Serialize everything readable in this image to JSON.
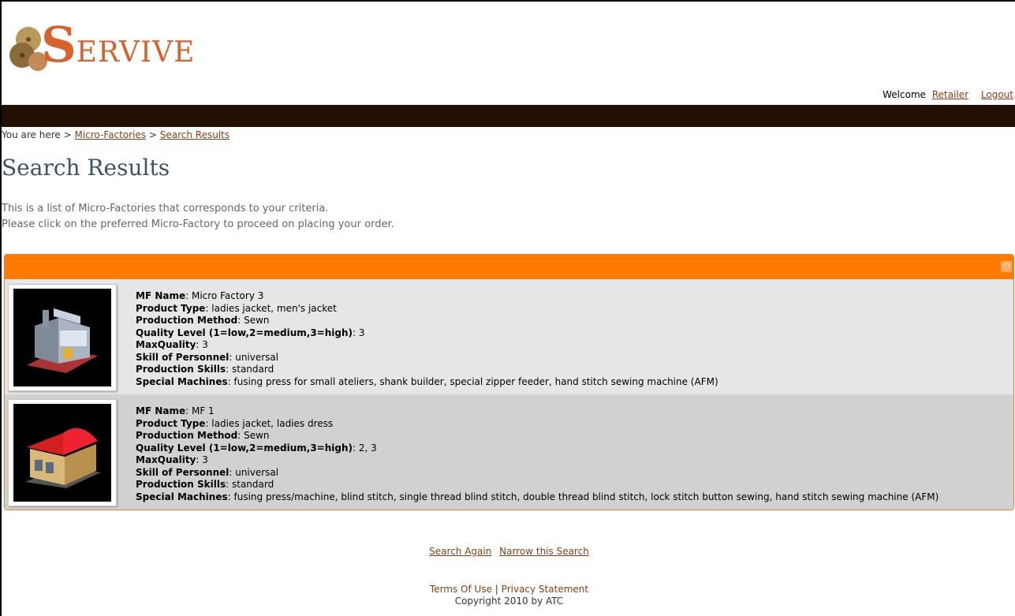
{
  "logo": {
    "first": "S",
    "rest": "ERVIVE"
  },
  "header": {
    "welcome": "Welcome",
    "user": "Retailer",
    "logout": "Logout"
  },
  "breadcrumb": {
    "prefix": "You are here >",
    "sep": ">",
    "item1": "Micro-Factories",
    "item2": "Search Results"
  },
  "page": {
    "title": "Search Results",
    "intro1": "This is a list of Micro-Factories that corresponds to your criteria.",
    "intro2": "Please click on the preferred Micro-Factory to proceed on placing your order."
  },
  "labels": {
    "name": "MF Name",
    "product": "Product Type",
    "method": "Production Method",
    "quality": "Quality Level (1=low,2=medium,3=high)",
    "maxq": "MaxQuality",
    "skill": "Skill of Personnel",
    "prodskills": "Production Skills",
    "machines": "Special Machines"
  },
  "results": [
    {
      "name": "Micro Factory 3",
      "product": "ladies jacket, men's jacket",
      "method": "Sewn",
      "quality": "3",
      "maxq": "3",
      "skill": "universal",
      "prodskills": "standard",
      "machines": "fusing press for small ateliers, shank builder, special zipper feeder, hand stitch sewing machine (AFM)"
    },
    {
      "name": "MF 1",
      "product": "ladies jacket, ladies dress",
      "method": "Sewn",
      "quality": "2, 3",
      "maxq": "3",
      "skill": "universal",
      "prodskills": "standard",
      "machines": "fusing press/machine, blind stitch, single thread blind stitch, double thread blind stitch, lock stitch button sewing, hand stitch sewing machine (AFM)"
    }
  ],
  "footer": {
    "search_again": "Search Again",
    "narrow": "Narrow this Search",
    "terms": "Terms Of Use",
    "sep": "|",
    "privacy": "Privacy Statement",
    "copyright": "Copyright 2010 by ATC"
  },
  "icons": {
    "rss": "rss-icon",
    "factory1": "factory-icon",
    "factory2": "factory-red-roof-icon"
  }
}
